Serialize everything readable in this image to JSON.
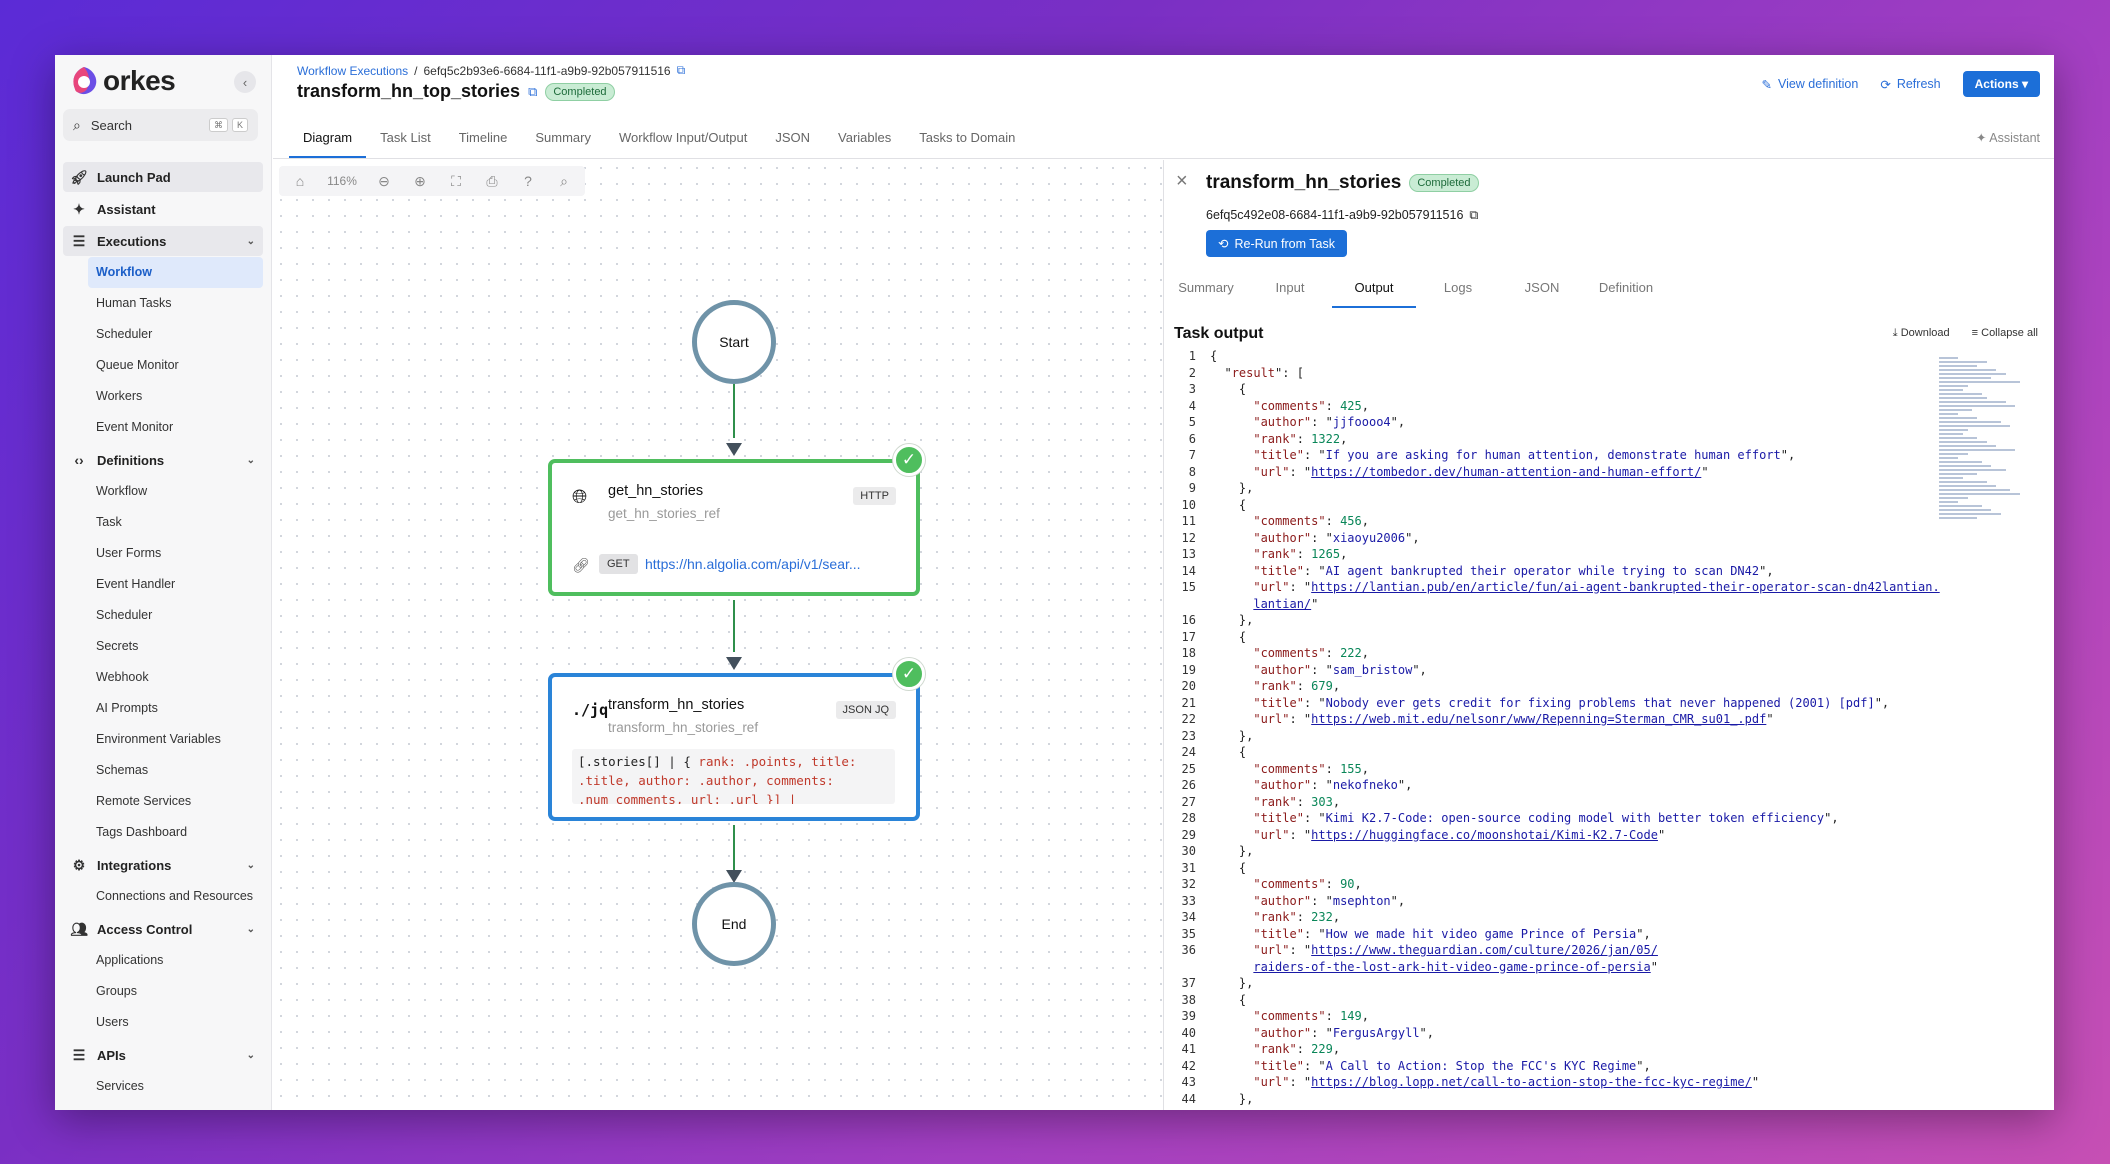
{
  "app": {
    "name": "orkes"
  },
  "sidebar": {
    "search_label": "Search",
    "kbd": [
      "⌘",
      "K"
    ],
    "items": [
      {
        "label": "Launch Pad",
        "icon": "rocket-icon",
        "top": true,
        "highlight": true
      },
      {
        "label": "Assistant",
        "icon": "sparkle-icon",
        "top": true
      },
      {
        "label": "Executions",
        "icon": "list-icon",
        "top": true,
        "highlight": true,
        "chevron": true
      },
      {
        "label": "Workflow",
        "sub": true,
        "active": true
      },
      {
        "label": "Human Tasks",
        "sub": true
      },
      {
        "label": "Scheduler",
        "sub": true
      },
      {
        "label": "Queue Monitor",
        "sub": true
      },
      {
        "label": "Workers",
        "sub": true
      },
      {
        "label": "Event Monitor",
        "sub": true
      },
      {
        "label": "Definitions",
        "icon": "code-icon",
        "top": true,
        "chevron": true
      },
      {
        "label": "Workflow",
        "sub": true
      },
      {
        "label": "Task",
        "sub": true
      },
      {
        "label": "User Forms",
        "sub": true
      },
      {
        "label": "Event Handler",
        "sub": true
      },
      {
        "label": "Scheduler",
        "sub": true
      },
      {
        "label": "Secrets",
        "sub": true
      },
      {
        "label": "Webhook",
        "sub": true
      },
      {
        "label": "AI Prompts",
        "sub": true
      },
      {
        "label": "Environment Variables",
        "sub": true
      },
      {
        "label": "Schemas",
        "sub": true
      },
      {
        "label": "Remote Services",
        "sub": true
      },
      {
        "label": "Tags Dashboard",
        "sub": true
      },
      {
        "label": "Integrations",
        "icon": "plug-icon",
        "top": true,
        "chevron": true
      },
      {
        "label": "Connections and Resources",
        "sub": true
      },
      {
        "label": "Access Control",
        "icon": "users-icon",
        "top": true,
        "chevron": true
      },
      {
        "label": "Applications",
        "sub": true
      },
      {
        "label": "Groups",
        "sub": true
      },
      {
        "label": "Users",
        "sub": true
      },
      {
        "label": "APIs",
        "icon": "server-icon",
        "top": true,
        "chevron": true
      },
      {
        "label": "Services",
        "sub": true
      }
    ]
  },
  "header": {
    "breadcrumb_link": "Workflow Executions",
    "breadcrumb_sep": "/",
    "execution_id": "6efq5c2b93e6-6684-11f1-a9b9-92b057911516",
    "title": "transform_hn_top_stories",
    "status": "Completed",
    "view_definition": "View definition",
    "refresh": "Refresh",
    "actions": "Actions"
  },
  "tabs": [
    "Diagram",
    "Task List",
    "Timeline",
    "Summary",
    "Workflow Input/Output",
    "JSON",
    "Variables",
    "Tasks to Domain"
  ],
  "active_tab": "Diagram",
  "assistant_label": "Assistant",
  "diagram": {
    "zoom": "116%",
    "start_label": "Start",
    "end_label": "End",
    "http_task": {
      "name": "get_hn_stories",
      "ref": "get_hn_stories_ref",
      "type": "HTTP",
      "method": "GET",
      "url": "https://hn.algolia.com/api/v1/sear..."
    },
    "jq_task": {
      "icon_text": "./jq",
      "name": "transform_hn_stories",
      "ref": "transform_hn_stories_ref",
      "type": "JSON JQ",
      "expr_plain": "[.stories[] | { ",
      "expr_l1": "rank: .points, title:",
      "expr_l2": ".title, author: .author, comments:",
      "expr_l3": ".num_comments, url: .url }] |"
    }
  },
  "detail": {
    "title": "transform_hn_stories",
    "status": "Completed",
    "task_id": "6efq5c492e08-6684-11f1-a9b9-92b057911516",
    "rerun": "Re-Run from Task",
    "tabs": [
      "Summary",
      "Input",
      "Output",
      "Logs",
      "JSON",
      "Definition"
    ],
    "active_tab": "Output",
    "output_heading": "Task output",
    "download": "Download",
    "collapse_all": "Collapse all"
  },
  "output": {
    "root_key": "result",
    "items": [
      {
        "comments": 425,
        "author": "jjfoooo4",
        "rank": 1322,
        "title": "If you are asking for human attention, demonstrate human effort",
        "url": "https://tombedor.dev/human-attention-and-human-effort/"
      },
      {
        "comments": 456,
        "author": "xiaoyu2006",
        "rank": 1265,
        "title": "AI agent bankrupted their operator while trying to scan DN42",
        "url": "https://lantian.pub/en/article/fun/ai-agent-bankrupted-their-operator-scan-dn42lantian.",
        "url2": "lantian/"
      },
      {
        "comments": 222,
        "author": "sam_bristow",
        "rank": 679,
        "title": "Nobody ever gets credit for fixing problems that never happened (2001) [pdf]",
        "url": "https://web.mit.edu/nelsonr/www/Repenning=Sterman_CMR_su01_.pdf"
      },
      {
        "comments": 155,
        "author": "nekofneko",
        "rank": 303,
        "title": "Kimi K2.7-Code: open-source coding model with better token efficiency",
        "url": "https://huggingface.co/moonshotai/Kimi-K2.7-Code"
      },
      {
        "comments": 90,
        "author": "msephton",
        "rank": 232,
        "title": "How we made hit video game Prince of Persia",
        "url": "https://www.theguardian.com/culture/2026/jan/05/",
        "url2": "raiders-of-the-lost-ark-hit-video-game-prince-of-persia"
      },
      {
        "comments": 149,
        "author": "FergusArgyll",
        "rank": 229,
        "title": "A Call to Action: Stop the FCC's KYC Regime",
        "url": "https://blog.lopp.net/call-to-action-stop-the-fcc-kyc-regime/"
      }
    ]
  }
}
